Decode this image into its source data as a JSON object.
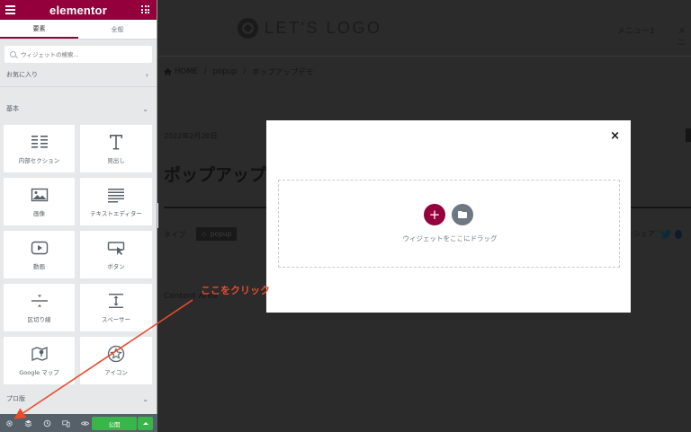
{
  "panel": {
    "logo": "elementor",
    "tabs": [
      {
        "label": "要素",
        "active": true
      },
      {
        "label": "全般",
        "active": false
      }
    ],
    "search": {
      "placeholder": "ウィジェットの検索..."
    },
    "sections": {
      "favorites": "お気に入り",
      "basic": "基本",
      "pro": "プロ版"
    },
    "widgets": [
      {
        "label": "内部セクション",
        "icon": "inner-section-icon"
      },
      {
        "label": "見出し",
        "icon": "heading-icon"
      },
      {
        "label": "画像",
        "icon": "image-icon"
      },
      {
        "label": "テキストエディター",
        "icon": "text-editor-icon"
      },
      {
        "label": "動画",
        "icon": "video-icon"
      },
      {
        "label": "ボタン",
        "icon": "button-icon"
      },
      {
        "label": "区切り線",
        "icon": "divider-icon"
      },
      {
        "label": "スペーサー",
        "icon": "spacer-icon"
      },
      {
        "label": "Google マップ",
        "icon": "google-maps-icon"
      },
      {
        "label": "アイコン",
        "icon": "icon-widget-icon"
      }
    ],
    "footer": {
      "publish_label": "公開"
    }
  },
  "site": {
    "logo_text": "LET'S LOGO",
    "nav": [
      "メニュー1",
      "メニ"
    ],
    "breadcrumb": [
      "HOME",
      "popup",
      "ポップアップデモ"
    ],
    "post_date": "2022年2月20日",
    "post_title": "ポップアップ",
    "type_label": "タイプ",
    "tag": "popup",
    "share_label": "をシェア",
    "content_area": "Content Area"
  },
  "popup": {
    "close": "×",
    "drop_text": "ウィジェットをここにドラッグ"
  },
  "annotation": {
    "text": "ここをクリック",
    "color": "#e84c2f"
  },
  "colors": {
    "brand": "#93003c",
    "publish": "#39b54a",
    "panel_bg": "#e6e8ea",
    "footer_bg": "#556068"
  }
}
